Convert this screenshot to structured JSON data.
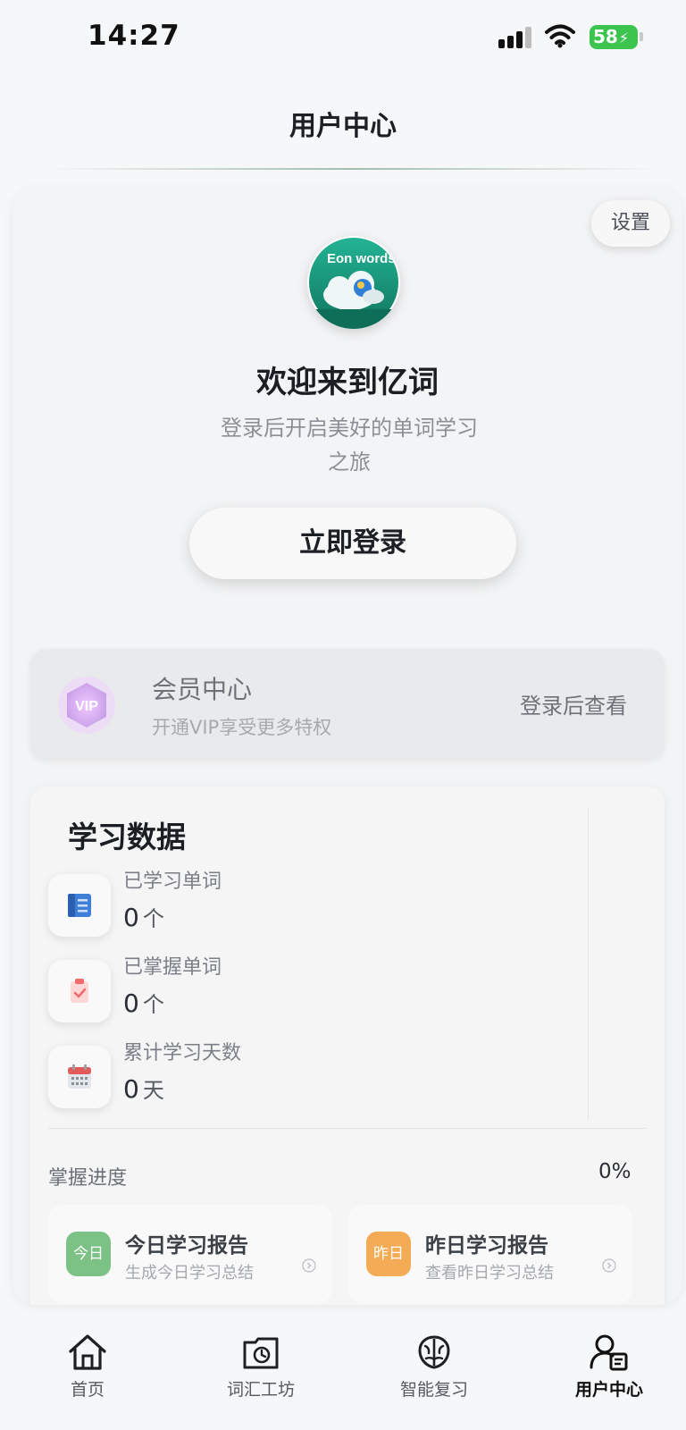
{
  "status_bar": {
    "time": "14:27",
    "battery": "58"
  },
  "header": {
    "title": "用户中心"
  },
  "profile": {
    "settings_label": "设置",
    "logo_text": "Eon words",
    "welcome_title": "欢迎来到亿词",
    "welcome_subtitle": "登录后开启美好的单词学习之旅",
    "login_label": "立即登录"
  },
  "vip": {
    "badge_text": "VIP",
    "title": "会员中心",
    "subtitle": "开通VIP享受更多特权",
    "action": "登录后查看"
  },
  "stats": {
    "title": "学习数据",
    "items": [
      {
        "label": "已学习单词",
        "value": "0",
        "unit": "个",
        "icon": "book-icon"
      },
      {
        "label": "已掌握单词",
        "value": "0",
        "unit": "个",
        "icon": "clipboard-check-icon"
      },
      {
        "label": "累计学习天数",
        "value": "0",
        "unit": "天",
        "icon": "calendar-icon"
      }
    ],
    "progress_label": "掌握进度",
    "progress_value": "0%"
  },
  "reports": [
    {
      "badge": "今日",
      "title": "今日学习报告",
      "subtitle": "生成今日学习总结",
      "color": "#7cc286"
    },
    {
      "badge": "昨日",
      "title": "昨日学习报告",
      "subtitle": "查看昨日学习总结",
      "color": "#f4ab55"
    }
  ],
  "tabbar": {
    "items": [
      {
        "label": "首页",
        "icon": "home-icon"
      },
      {
        "label": "词汇工坊",
        "icon": "vocab-workshop-icon"
      },
      {
        "label": "智能复习",
        "icon": "brain-icon"
      },
      {
        "label": "用户中心",
        "icon": "user-center-icon"
      }
    ],
    "active_index": 3
  }
}
